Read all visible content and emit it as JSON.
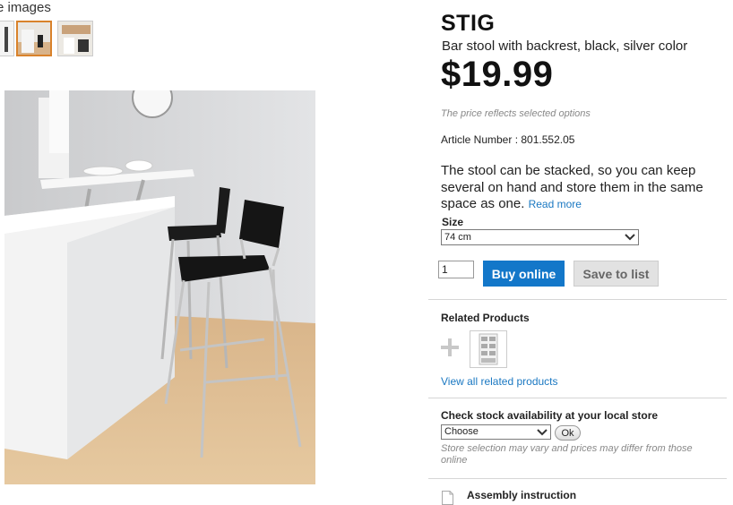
{
  "gallery": {
    "more_images_label": "e images",
    "thumbnails": [
      "thumb-1",
      "thumb-2-selected",
      "thumb-3"
    ]
  },
  "product": {
    "name": "STIG",
    "description": "Bar stool with backrest, black, silver color",
    "price": "$19.99",
    "price_note": "The price reflects selected options",
    "article_label": "Article Number : ",
    "article_number": "801.552.05",
    "summary": "The stool can be stacked, so you can keep several on hand and store them in the same space as one.",
    "read_more": "Read more"
  },
  "size": {
    "label": "Size",
    "selected": "74 cm"
  },
  "purchase": {
    "quantity": "1",
    "buy_label": "Buy online",
    "save_label": "Save to list"
  },
  "related": {
    "title": "Related Products",
    "view_all": "View all related products"
  },
  "stock": {
    "title": "Check stock availability at your local store",
    "store_selected": "Choose",
    "ok_label": "Ok",
    "note": "Store selection may vary and prices may differ from those online"
  },
  "assembly": {
    "label": "Assembly instruction"
  },
  "colors": {
    "buy_button": "#1377c9",
    "link": "#1a78c2",
    "selected_thumb_border": "#d9822b"
  }
}
